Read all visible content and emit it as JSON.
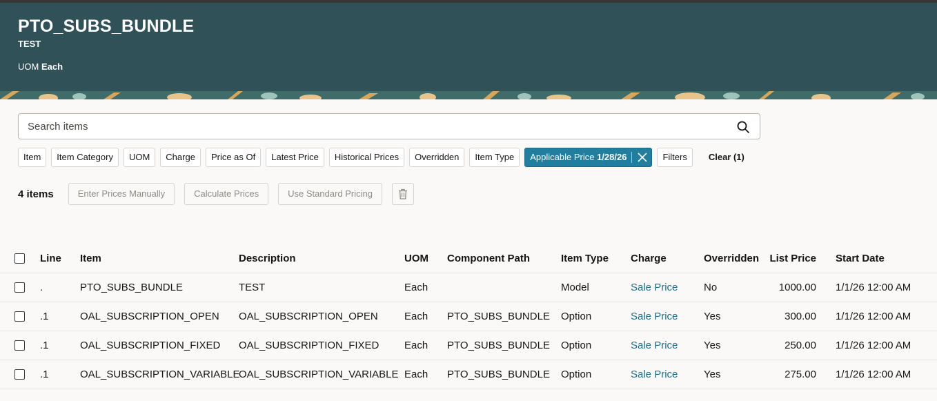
{
  "header": {
    "title": "PTO_SUBS_BUNDLE",
    "subtitle": "TEST",
    "uom_label": "UOM",
    "uom_value": "Each"
  },
  "search": {
    "placeholder": "Search items"
  },
  "filters": {
    "chips": [
      "Item",
      "Item Category",
      "UOM",
      "Charge",
      "Price as Of",
      "Latest Price",
      "Historical Prices",
      "Overridden",
      "Item Type"
    ],
    "active_chip": {
      "label": "Applicable Price",
      "value": "1/28/26"
    },
    "filters_label": "Filters",
    "clear_label": "Clear (1)"
  },
  "toolbar": {
    "count": "4 items",
    "enter_prices": "Enter Prices Manually",
    "calculate_prices": "Calculate Prices",
    "use_standard": "Use Standard Pricing"
  },
  "table": {
    "headers": {
      "line": "Line",
      "item": "Item",
      "description": "Description",
      "uom": "UOM",
      "component_path": "Component Path",
      "item_type": "Item Type",
      "charge": "Charge",
      "overridden": "Overridden",
      "list_price": "List Price",
      "start_date": "Start Date"
    },
    "rows": [
      {
        "line": ".",
        "item": "PTO_SUBS_BUNDLE",
        "description": "TEST",
        "uom": "Each",
        "component_path": "",
        "item_type": "Model",
        "charge": "Sale Price",
        "overridden": "No",
        "list_price": "1000.00",
        "start_date": "1/1/26 12:00 AM"
      },
      {
        "line": ".1",
        "item": "OAL_SUBSCRIPTION_OPEN",
        "description": "OAL_SUBSCRIPTION_OPEN",
        "uom": "Each",
        "component_path": "PTO_SUBS_BUNDLE",
        "item_type": "Option",
        "charge": "Sale Price",
        "overridden": "Yes",
        "list_price": "300.00",
        "start_date": "1/1/26 12:00 AM"
      },
      {
        "line": ".1",
        "item": "OAL_SUBSCRIPTION_FIXED",
        "description": "OAL_SUBSCRIPTION_FIXED",
        "uom": "Each",
        "component_path": "PTO_SUBS_BUNDLE",
        "item_type": "Option",
        "charge": "Sale Price",
        "overridden": "Yes",
        "list_price": "250.00",
        "start_date": "1/1/26 12:00 AM"
      },
      {
        "line": ".1",
        "item": "OAL_SUBSCRIPTION_VARIABLE",
        "description": "OAL_SUBSCRIPTION_VARIABLE",
        "uom": "Each",
        "component_path": "PTO_SUBS_BUNDLE",
        "item_type": "Option",
        "charge": "Sale Price",
        "overridden": "Yes",
        "list_price": "275.00",
        "start_date": "1/1/26 12:00 AM"
      }
    ]
  },
  "colors": {
    "header_bg": "#2f5157",
    "active_chip_bg": "#227e9e",
    "link": "#1b6d8c"
  }
}
